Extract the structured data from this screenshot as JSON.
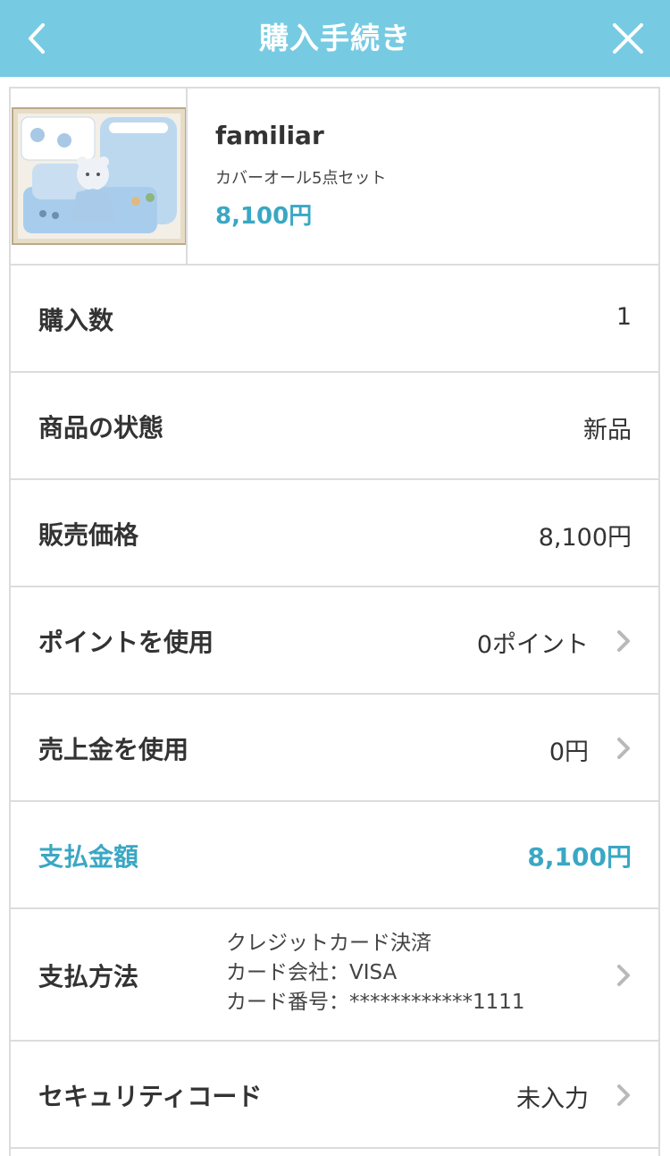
{
  "header": {
    "title": "購入手続き"
  },
  "product": {
    "brand": "familiar",
    "name": "カバーオール5点セット",
    "price": "8,100円"
  },
  "rows": [
    {
      "label": "購入数",
      "value": "1"
    },
    {
      "label": "商品の状態",
      "value": "新品"
    },
    {
      "label": "販売価格",
      "value": "8,100円"
    },
    {
      "label": "ポイントを使用",
      "value": "0ポイント"
    },
    {
      "label": "売上金を使用",
      "value": "0円"
    },
    {
      "label": "支払金額",
      "value": "8,100円"
    }
  ],
  "payment": {
    "label": "支払方法",
    "line1": "クレジットカード決済",
    "line2": "カード会社：VISA",
    "line3": "カード番号：************1111"
  },
  "security": {
    "label": "セキュリティコード",
    "value": "未入力"
  },
  "colors": {
    "header": "#76cbe3",
    "accent": "#3aa7c4",
    "border": "#dcdcdc"
  },
  "icons": {
    "back": "chevron-left-icon",
    "close": "close-icon",
    "row_arrow": "chevron-right-icon"
  }
}
